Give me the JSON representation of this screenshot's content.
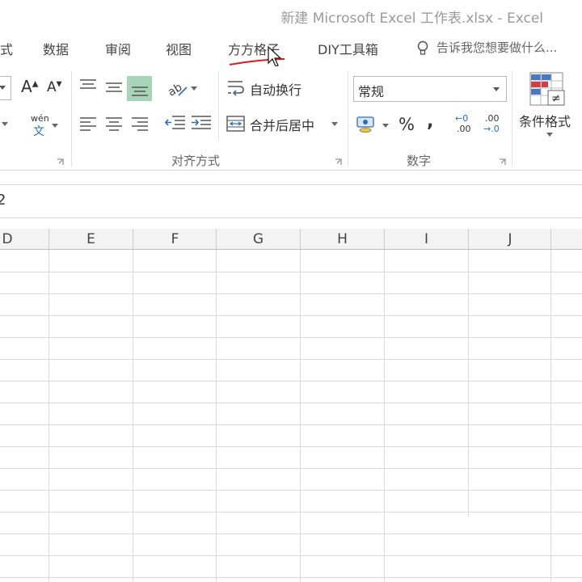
{
  "window": {
    "title": "新建 Microsoft Excel 工作表.xlsx - Excel"
  },
  "tabs": [
    {
      "label": "式"
    },
    {
      "label": "数据"
    },
    {
      "label": "审阅"
    },
    {
      "label": "视图"
    },
    {
      "label": "方方格子"
    },
    {
      "label": "DIY工具箱"
    }
  ],
  "tell_me": {
    "label": "告诉我您想要做什么..."
  },
  "ribbon": {
    "wrap_text": "自动换行",
    "merge_center": "合并后居中",
    "number_format": "常规",
    "percent": "%",
    "comma": ",",
    "conditional_format": "条件格式",
    "group_alignment": "对齐方式",
    "group_number": "数字",
    "font_grow": "A",
    "font_shrink": "A",
    "phonetic_top": "wén",
    "phonetic_bottom": "文",
    "dec_increase_top": "←0",
    "dec_increase_bottom": ".00",
    "dec_decrease_top": ".00",
    "dec_decrease_bottom": "→.0"
  },
  "formula_bar": {
    "name_box": "2"
  },
  "columns": [
    "D",
    "E",
    "F",
    "G",
    "H",
    "I",
    "J"
  ],
  "colors": {
    "accent_green": "#a7d5b8",
    "annotation_red": "#cc2222"
  }
}
